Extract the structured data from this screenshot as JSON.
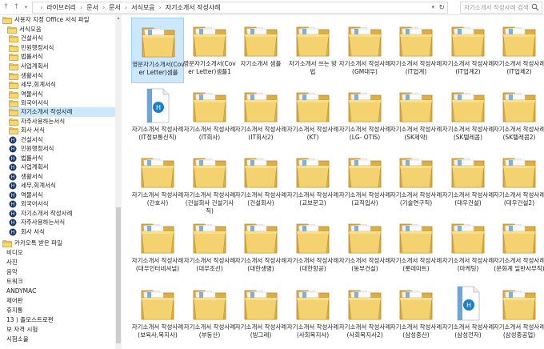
{
  "address_bar": {
    "breadcrumbs": [
      "라이브러리",
      "문서",
      "문서",
      "서식모음",
      "자기소개서 작성사례"
    ]
  },
  "search": {
    "placeholder": "자기소개서 작성사례 검색"
  },
  "sidebar": {
    "items": [
      {
        "label": "사용자 지정 Office 서식 파일",
        "icon": "folder-icon"
      },
      {
        "label": "서식모음",
        "icon": "folder-icon"
      },
      {
        "label": "건설서식",
        "icon": "folder-icon"
      },
      {
        "label": "민원행정서식",
        "icon": "folder-icon"
      },
      {
        "label": "법률서식",
        "icon": "folder-icon"
      },
      {
        "label": "사업계획서",
        "icon": "folder-icon"
      },
      {
        "label": "생활서식",
        "icon": "folder-icon"
      },
      {
        "label": "세무,회계서식",
        "icon": "folder-icon"
      },
      {
        "label": "역물서식",
        "icon": "folder-icon"
      },
      {
        "label": "외국어서식",
        "icon": "folder-icon"
      },
      {
        "label": "자기소개서 작성사례",
        "icon": "folder-icon",
        "selected": true
      },
      {
        "label": "자주사용하는서식",
        "icon": "folder-icon"
      },
      {
        "label": "회사 서식",
        "icon": "folder-icon"
      },
      {
        "label": "건설서식",
        "icon": "hwp-icon"
      },
      {
        "label": "민원행정서식",
        "icon": "hwp-icon"
      },
      {
        "label": "법률서식",
        "icon": "hwp-icon"
      },
      {
        "label": "사업계획서",
        "icon": "hwp-icon"
      },
      {
        "label": "생활서식",
        "icon": "hwp-icon"
      },
      {
        "label": "세무,회계서식",
        "icon": "hwp-icon"
      },
      {
        "label": "역물서식",
        "icon": "hwp-icon"
      },
      {
        "label": "외국어서식",
        "icon": "hwp-icon"
      },
      {
        "label": "자기소개서 작성사례",
        "icon": "hwp-icon"
      },
      {
        "label": "자주사용하는서식",
        "icon": "hwp-icon"
      },
      {
        "label": "회사 서식",
        "icon": "hwp-icon"
      },
      {
        "label": "카카오톡 받은 파일",
        "icon": "folder-icon"
      },
      {
        "label": "비디오",
        "icon": "none"
      },
      {
        "label": "사진",
        "icon": "none"
      },
      {
        "label": "음악",
        "icon": "none"
      },
      {
        "label": "트워크",
        "icon": "none"
      },
      {
        "label": "ANDYMAC",
        "icon": "none"
      },
      {
        "label": "제어판",
        "icon": "none"
      },
      {
        "label": "휴지통",
        "icon": "none"
      },
      {
        "label": "13 ) 졸모스트로편",
        "icon": "none"
      },
      {
        "label": "보 자격 시험",
        "icon": "none"
      },
      {
        "label": "시험소울",
        "icon": "none"
      }
    ]
  },
  "files": [
    {
      "label": "영문자기소개서(Cover Letter)샘플",
      "icon": "folder",
      "selected": true
    },
    {
      "label": "영문자기소개서(Cover Letter)샘플1",
      "icon": "folder"
    },
    {
      "label": "자기소개서 샘플",
      "icon": "folder"
    },
    {
      "label": "자기소개서 쓰는 방법",
      "icon": "folder"
    },
    {
      "label": "자기소개서 작성사례(GM대우)",
      "icon": "folder"
    },
    {
      "label": "자기소개서 작성사례(IT업계)",
      "icon": "folder"
    },
    {
      "label": "자기소개서 작성사례(IT업계2)",
      "icon": "folder"
    },
    {
      "label": "자기소개서 작성사례(IT업체2)",
      "icon": "folder"
    },
    {
      "label": "자기소개서 작성사례(IT정보통신직)",
      "icon": "hwp"
    },
    {
      "label": "자기소개서 작성사례(IT회사)",
      "icon": "folder"
    },
    {
      "label": "자기소개서 작성사례(IT회사2)",
      "icon": "folder"
    },
    {
      "label": "자기소개서 작성사례(KT)",
      "icon": "folder"
    },
    {
      "label": "자기소개서 작성사례(LG- OTIS)",
      "icon": "folder"
    },
    {
      "label": "자기소개서 작성사례(SK제약)",
      "icon": "folder"
    },
    {
      "label": "자기소개서 작성사례(SK텔레콤)",
      "icon": "folder"
    },
    {
      "label": "자기소개서 작성사례(SK텔레콤2)",
      "icon": "folder"
    },
    {
      "label": "자기소개서 작성사례(간호사)",
      "icon": "folder"
    },
    {
      "label": "자기소개서 작성사례(건설회사 건설기사직)",
      "icon": "folder"
    },
    {
      "label": "자기소개서 작성사례(건설회사)",
      "icon": "folder"
    },
    {
      "label": "자기소개서 작성사례(교보문고)",
      "icon": "folder"
    },
    {
      "label": "자기소개서 작성사례(교직입사)",
      "icon": "folder"
    },
    {
      "label": "자기소개서 작성사례(기술연구직)",
      "icon": "folder"
    },
    {
      "label": "자기소개서 작성사례(대우건설)",
      "icon": "folder"
    },
    {
      "label": "자기소개서 작성사례(대우건설2)",
      "icon": "folder"
    },
    {
      "label": "자기소개서 작성사례(대우인터네셔널)",
      "icon": "folder"
    },
    {
      "label": "자기소개서 작성사례(대우조선)",
      "icon": "folder"
    },
    {
      "label": "자기소개서 작성사례(대한생명)",
      "icon": "folder"
    },
    {
      "label": "자기소개서 작성사례(대한항공)",
      "icon": "folder"
    },
    {
      "label": "자기소개서 작성사례(동부건설)",
      "icon": "folder"
    },
    {
      "label": "자기소개서 작성사례(롯데마트)",
      "icon": "folder"
    },
    {
      "label": "자기소개서 작성사례(마케팅)",
      "icon": "folder"
    },
    {
      "label": "자기소개서 작성사례(문화계 일반사무직)",
      "icon": "folder"
    },
    {
      "label": "자기소개서 작성사례(보육사,복지사)",
      "icon": "folder"
    },
    {
      "label": "자기소개서 작성사례(부동산)",
      "icon": "folder"
    },
    {
      "label": "자기소개서 작성사례(빙그레)",
      "icon": "folder"
    },
    {
      "label": "자기소개서 작성사례(사회복지사)",
      "icon": "folder"
    },
    {
      "label": "자기소개서 작성사례(사회복지사2)",
      "icon": "folder"
    },
    {
      "label": "자기소개서 작성사례(삼성중산)",
      "icon": "folder"
    },
    {
      "label": "자기소개서 작성사례(삼성전자)",
      "icon": "hwp"
    },
    {
      "label": "자기소개서 작성사례(삼성중공업)",
      "icon": "folder"
    }
  ]
}
